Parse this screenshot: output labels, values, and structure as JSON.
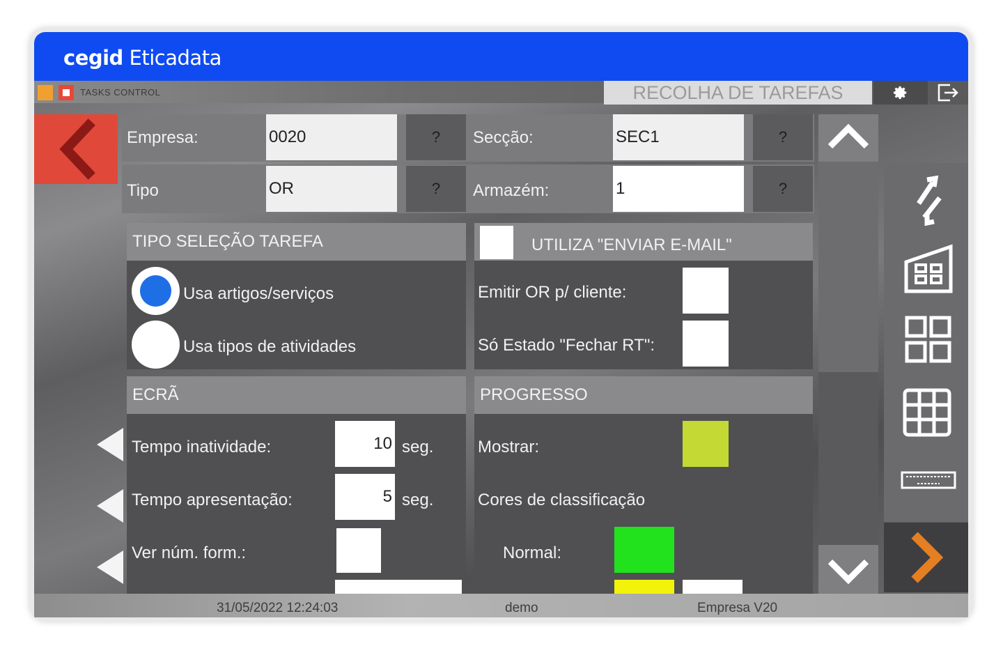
{
  "brand": {
    "bold": "cegid",
    "name": "Eticadata"
  },
  "app": {
    "name": "TASKS CONTROL",
    "screen_title": "RECOLHA DE TAREFAS"
  },
  "form": {
    "empresa": {
      "label": "Empresa:",
      "value": "0020",
      "lookup": "?"
    },
    "tipo": {
      "label": "Tipo",
      "value": "OR",
      "lookup": "?"
    },
    "seccao": {
      "label": "Secção:",
      "value": "SEC1",
      "lookup": "?"
    },
    "armazem": {
      "label": "Armazém:",
      "value": "1",
      "lookup": "?"
    }
  },
  "tipo_selecao": {
    "title": "TIPO SELEÇÃO TAREFA",
    "options": [
      {
        "label": "Usa artigos/serviços",
        "selected": true
      },
      {
        "label": "Usa tipos de atividades",
        "selected": false
      }
    ]
  },
  "email": {
    "title": "UTILIZA \"ENVIAR E-MAIL\"",
    "emitir_label": "Emitir OR p/ cliente:",
    "estado_label": "Só Estado \"Fechar RT\":"
  },
  "ecra": {
    "title": "ECRÃ",
    "inatividade": {
      "label": "Tempo inatividade:",
      "value": "10",
      "unit": "seg."
    },
    "apresentacao": {
      "label": "Tempo apresentação:",
      "value": "5",
      "unit": "seg."
    },
    "ver_num": {
      "label": "Ver núm. form.:"
    }
  },
  "progresso": {
    "title": "PROGRESSO",
    "mostrar_label": "Mostrar:",
    "mostrar_color": "#c5d934",
    "cores_label": "Cores de classificação",
    "normal_label": "Normal:",
    "normal_color": "#22e11d",
    "second_color": "#f2f20a"
  },
  "status": {
    "datetime": "31/05/2022 12:24:03",
    "user": "demo",
    "company": "Empresa V20"
  },
  "colors": {
    "brand_blue": "#0f4bf0",
    "back_red": "#e0483a",
    "next_orange": "#e67e22",
    "radio_blue": "#1e6fe6"
  },
  "icons": [
    "back-arrow-icon",
    "gear-icon",
    "exit-icon",
    "sync-icon",
    "store-icon",
    "grid-2x2-icon",
    "grid-3x3-icon",
    "keyboard-icon",
    "next-arrow-icon",
    "scroll-up-icon",
    "scroll-down-icon"
  ]
}
